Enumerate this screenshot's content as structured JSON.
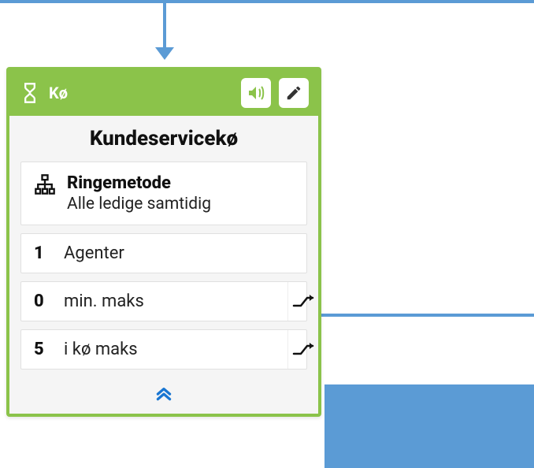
{
  "colors": {
    "accent": "#8bc34a",
    "connector": "#5b9bd5"
  },
  "header": {
    "title": "Kø"
  },
  "queue": {
    "title": "Kundeservicekø"
  },
  "method": {
    "label": "Ringemetode",
    "value": "Alle ledige samtidig"
  },
  "rows": [
    {
      "count": "1",
      "label": "Agenter",
      "action": false
    },
    {
      "count": "0",
      "label": "min. maks",
      "action": true
    },
    {
      "count": "5",
      "label": "i kø maks",
      "action": true
    }
  ],
  "icons": {
    "hourglass": "hourglass-icon",
    "sound": "sound-icon",
    "edit": "edit-icon",
    "hierarchy": "hierarchy-icon",
    "branch": "branch-icon",
    "collapse": "chevron-double-up-icon"
  }
}
